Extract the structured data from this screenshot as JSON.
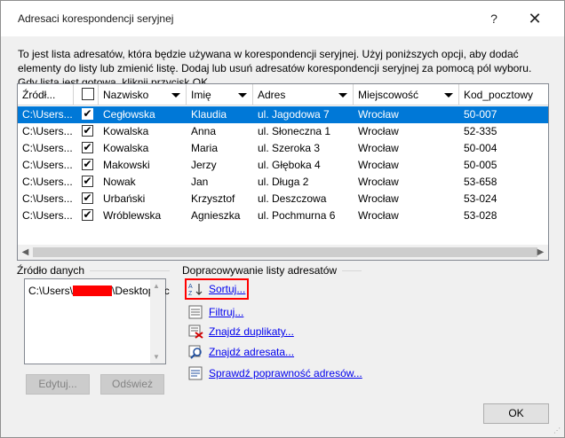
{
  "window": {
    "title": "Adresaci korespondencji seryjnej",
    "help_glyph": "?",
    "close_glyph": "✕"
  },
  "intro_text": "To jest lista adresatów, która będzie używana w korespondencji seryjnej. Użyj poniższych opcji, aby dodać elementy do listy lub zmienić listę. Dodaj lub usuń adresatów korespondencji seryjnej za pomocą pól wyboru. Gdy lista jest gotowa, kliknij przycisk OK.",
  "table": {
    "columns": [
      "Źródł...",
      "",
      "Nazwisko",
      "Imię",
      "Adres",
      "Miejscowość",
      "Kod_pocztowy"
    ],
    "rows": [
      {
        "source": "C:\\Users...",
        "checked": "✔",
        "nazwisko": "Cegłowska",
        "imie": "Klaudia",
        "adres": "ul. Jagodowa 7",
        "miejscowosc": "Wrocław",
        "kod": "50-007"
      },
      {
        "source": "C:\\Users...",
        "checked": "✔",
        "nazwisko": "Kowalska",
        "imie": "Anna",
        "adres": "ul. Słoneczna 1",
        "miejscowosc": "Wrocław",
        "kod": "52-335"
      },
      {
        "source": "C:\\Users...",
        "checked": "✔",
        "nazwisko": "Kowalska",
        "imie": "Maria",
        "adres": "ul. Szeroka 3",
        "miejscowosc": "Wrocław",
        "kod": "50-004"
      },
      {
        "source": "C:\\Users...",
        "checked": "✔",
        "nazwisko": "Makowski",
        "imie": "Jerzy",
        "adres": "ul. Głęboka 4",
        "miejscowosc": "Wrocław",
        "kod": "50-005"
      },
      {
        "source": "C:\\Users...",
        "checked": "✔",
        "nazwisko": "Nowak",
        "imie": "Jan",
        "adres": "ul. Długa 2",
        "miejscowosc": "Wrocław",
        "kod": "53-658"
      },
      {
        "source": "C:\\Users...",
        "checked": "✔",
        "nazwisko": "Urbański",
        "imie": "Krzysztof",
        "adres": "ul. Deszczowa",
        "miejscowosc": "Wrocław",
        "kod": "53-024"
      },
      {
        "source": "C:\\Users...",
        "checked": "✔",
        "nazwisko": "Wróblewska",
        "imie": "Agnieszka",
        "adres": "ul. Pochmurna 6",
        "miejscowosc": "Wrocław",
        "kod": "53-028"
      }
    ],
    "selected_row": 0
  },
  "data_source": {
    "label": "Źródło danych",
    "item_prefix": "C:\\Users\\",
    "item_suffix": "\\Desktop\\Ac",
    "edit_button": "Edytuj...",
    "refresh_button": "Odśwież"
  },
  "refine": {
    "label": "Dopracowywanie listy adresatów",
    "links": [
      {
        "label": "Sortuj...",
        "icon": "sort-az-icon"
      },
      {
        "label": "Filtruj...",
        "icon": "filter-icon"
      },
      {
        "label": "Znajdź duplikaty...",
        "icon": "duplicates-icon"
      },
      {
        "label": "Znajdź adresata...",
        "icon": "find-magnifier-icon"
      },
      {
        "label": "Sprawdź poprawność adresów...",
        "icon": "validate-address-icon"
      }
    ]
  },
  "ok_button": "OK",
  "colors": {
    "selection": "#0078d7",
    "link": "#0000ee",
    "highlight": "#ff0000"
  }
}
